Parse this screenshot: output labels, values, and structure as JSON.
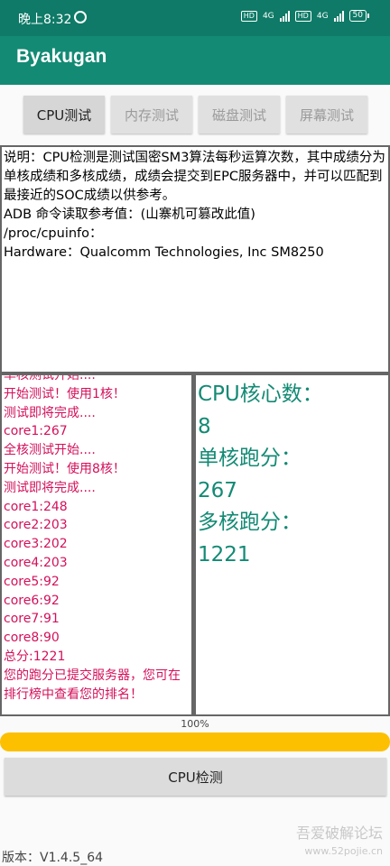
{
  "status_bar": {
    "time": "晚上8:32",
    "hd1": "HD",
    "net1": "4G",
    "hd2": "HD",
    "net2": "4G",
    "battery": "50"
  },
  "app": {
    "title": "Byakugan"
  },
  "tabs": [
    {
      "label": "CPU测试",
      "active": true
    },
    {
      "label": "内存测试",
      "active": false
    },
    {
      "label": "磁盘测试",
      "active": false
    },
    {
      "label": "屏幕测试",
      "active": false
    }
  ],
  "info": {
    "description": "说明：CPU检测是测试国密SM3算法每秒运算次数，其中成绩分为单核成绩和多核成绩，成绩会提交到EPC服务器中，并可以匹配到最接近的SOC成绩以供参考。",
    "adb_hint": "ADB 命令读取参考值：(山寨机可篡改此值)",
    "path": "/proc/cpuinfo：",
    "hardware": "Hardware：Qualcomm Technologies, Inc SM8250"
  },
  "log": [
    "单核测试开始....",
    "开始测试！使用1核！",
    "测试即将完成....",
    "core1:267",
    "全核测试开始....",
    "开始测试！使用8核！",
    "测试即将完成....",
    "core1:248",
    "core2:203",
    "core3:202",
    "core4:203",
    "core5:92",
    "core6:92",
    "core7:91",
    "core8:90",
    "总分:1221",
    "您的跑分已提交服务器，您可在排行榜中查看您的排名！"
  ],
  "results": {
    "cores_label": "CPU核心数：",
    "cores_value": "8",
    "single_label": "单核跑分：",
    "single_value": "267",
    "multi_label": "多核跑分：",
    "multi_value": "1221"
  },
  "progress": {
    "text": "100%",
    "value": 1.0
  },
  "button": {
    "label": "CPU检测"
  },
  "version": "版本：V1.4.5_64",
  "watermark": {
    "line1": "吾爱破解论坛",
    "line2": "www.52pojie.cn"
  },
  "colors": {
    "primary": "#138a74",
    "status_bar": "#0e7a67",
    "log_text": "#d4105a",
    "progress": "#fcc000"
  }
}
